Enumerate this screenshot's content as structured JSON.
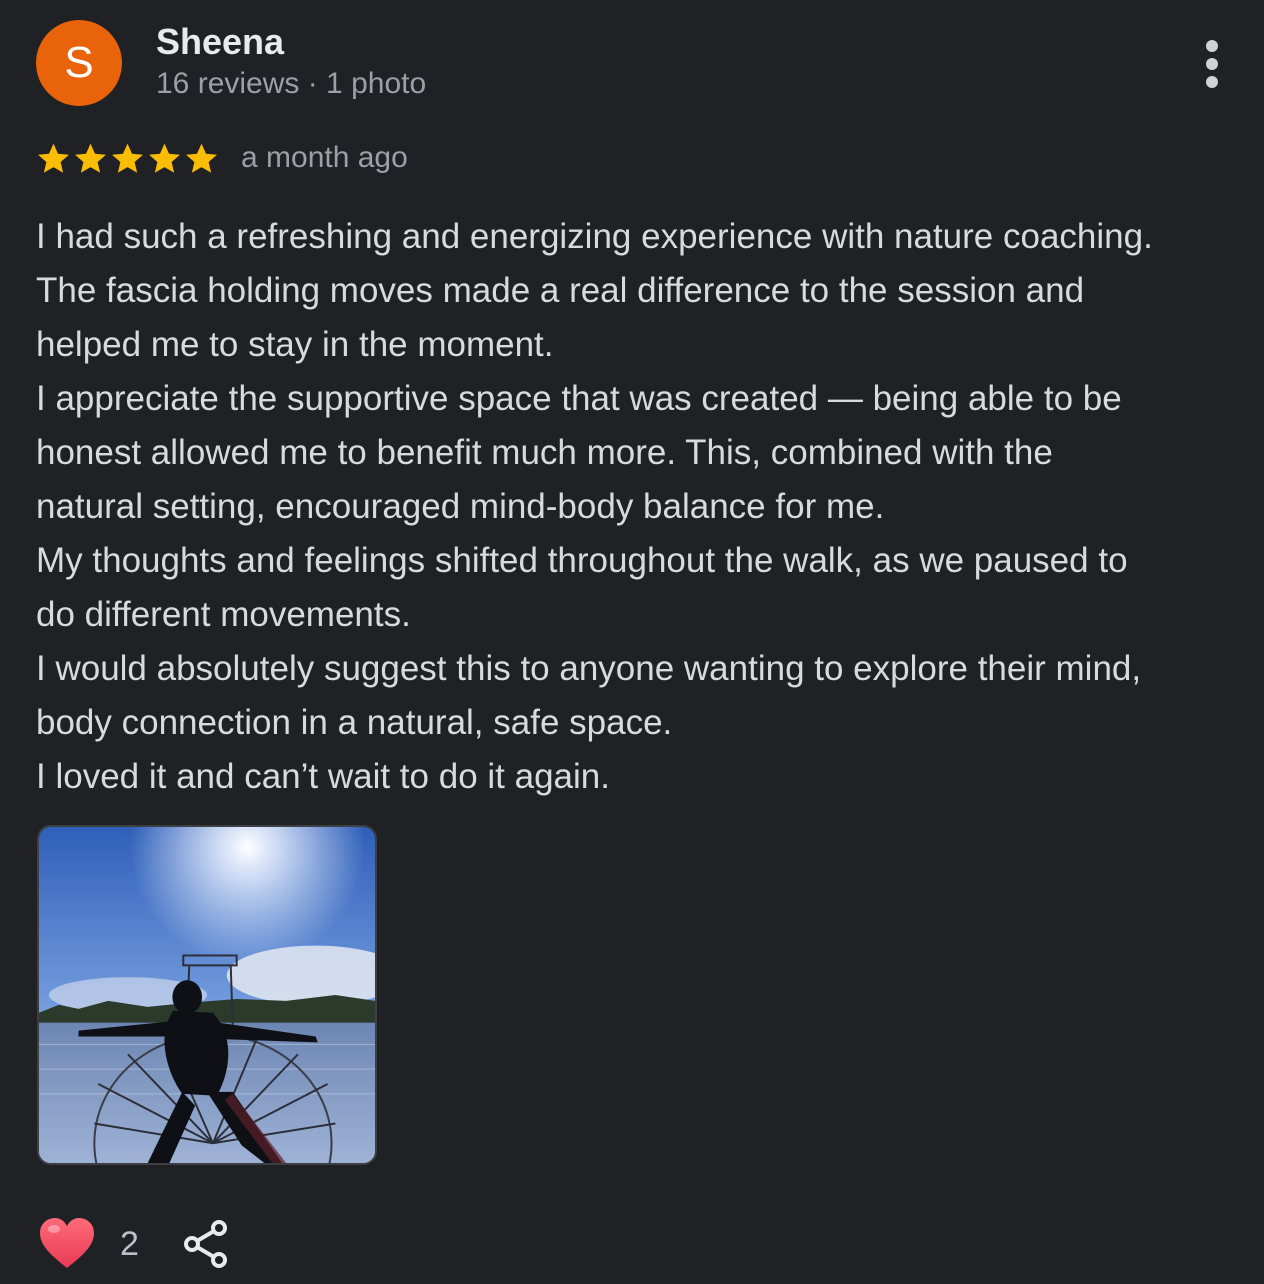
{
  "review": {
    "author": {
      "initial": "S",
      "name": "Sheena",
      "meta": "16 reviews · 1 photo"
    },
    "rating": 5,
    "time_ago": "a month ago",
    "text_lines": [
      "I had such a refreshing and energizing experience with nature coaching.",
      "The fascia holding moves made a real difference to the session and",
      "helped me to stay in the moment.",
      "I appreciate the supportive space that was created — being able to be",
      "honest allowed me to benefit much more. This, combined with the",
      "natural setting, encouraged mind-body balance for me.",
      "My thoughts and feelings shifted throughout the walk, as we paused to",
      "do different movements.",
      "I would absolutely suggest this to anyone wanting to explore their mind,",
      "body connection in a natural, safe space.",
      "I loved it and can’t wait to do it again."
    ],
    "like_count": "2"
  },
  "icons": {
    "more": "more-vert-icon",
    "star": "star-icon",
    "like": "heart-icon",
    "share": "share-icon"
  },
  "colors": {
    "background": "#202124",
    "avatar": "#e8630a",
    "star": "#fbbc04",
    "heart": "#f25a6a"
  }
}
